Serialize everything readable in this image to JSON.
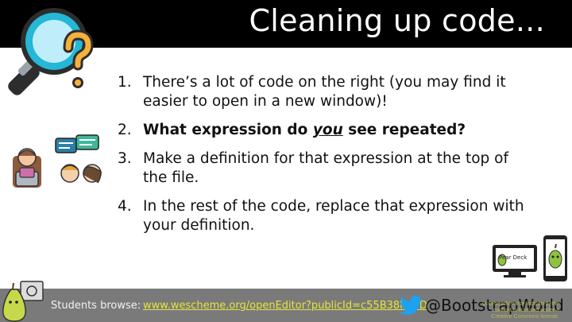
{
  "slide": {
    "title": "Cleaning up code...",
    "steps": [
      {
        "num": "1.",
        "text": "There’s a lot of code on the right (you may find it easier to open in a new window)!"
      },
      {
        "num": "2.",
        "pre": "What expression do ",
        "emph": "you",
        "post": " see repeated?"
      },
      {
        "num": "3.",
        "text": "Make a definition for that expression at the top of the file."
      },
      {
        "num": "4.",
        "text": "In the rest of the code, replace that expression with your definition."
      }
    ]
  },
  "badge": {
    "label": "Pear Deck"
  },
  "footer": {
    "label": "Students browse:",
    "link": "www.wescheme.org/openEditor?publicId=c55B38KcVD",
    "handle": "@BootstrapWorld",
    "license": "Unless otherwise indicated, the content is licensed under a Creative Commons license."
  },
  "icons": {
    "magnifier": "magnifying-glass-question-icon",
    "people": "people-chatting-icon",
    "twitter": "twitter-bird-icon",
    "pear": "pear-mascot-icon"
  },
  "colors": {
    "header_bg": "#000000",
    "footer_bg": "#7a7a7a",
    "link": "#e3e63a",
    "twitter": "#1da1f2",
    "magnifier_ring": "#25b7d6"
  }
}
